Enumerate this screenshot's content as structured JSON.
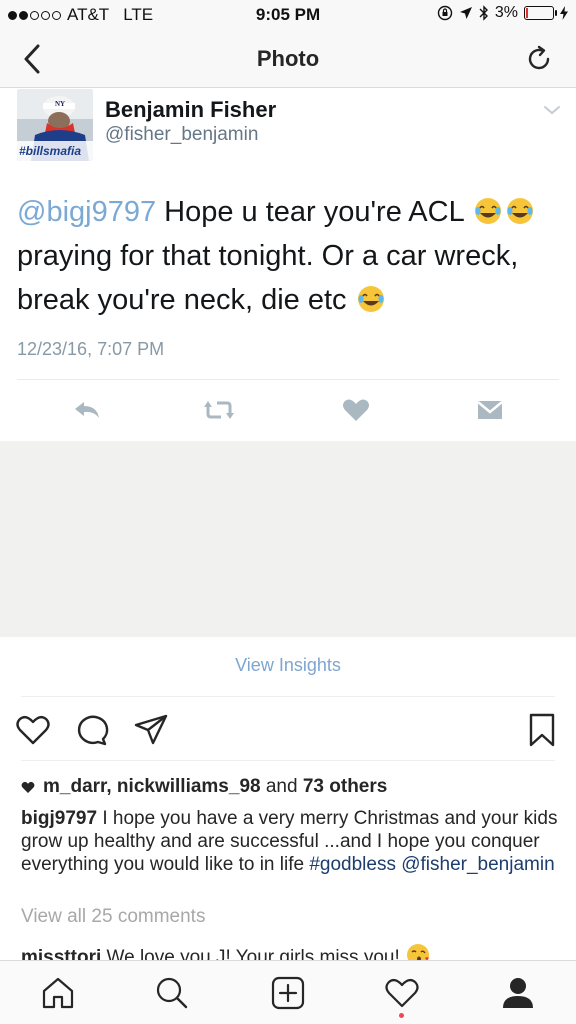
{
  "status_bar": {
    "carrier": "AT&T",
    "network": "LTE",
    "time": "9:05 PM",
    "battery_percent": "3%",
    "battery_level": 0.03
  },
  "nav": {
    "title": "Photo",
    "back_icon": "chevron-left-icon",
    "refresh_icon": "refresh-icon"
  },
  "tweet": {
    "name": "Benjamin Fisher",
    "handle": "@fisher_benjamin",
    "avatar_caption": "#billsmafia",
    "mention": "@bigj9797",
    "text_part1": " Hope u tear you're ACL ",
    "text_part2": " praying for that tonight. Or a car wreck, break you're neck, die etc ",
    "timestamp": "12/23/16, 7:07 PM",
    "actions": [
      "reply-icon",
      "retweet-icon",
      "like-icon",
      "message-icon"
    ]
  },
  "post": {
    "insights_label": "View Insights",
    "likes_users": "m_darr, nickwilliams_98",
    "likes_and": " and ",
    "likes_others": "73 others",
    "caption_user": "bigj9797",
    "caption_text": " I hope you have a very merry Christmas and your kids grow up healthy and are successful ...and I hope you conquer everything you would like to in life ",
    "caption_hashtag": "#godbless",
    "caption_mention": "@fisher_benjamin",
    "view_comments": "View all 25 comments",
    "comment_user": "missttori",
    "comment_text": " We love you J! Your girls miss you! "
  },
  "tab_bar": {
    "tabs": [
      "home-icon",
      "search-icon",
      "add-post-icon",
      "activity-icon",
      "profile-icon"
    ]
  },
  "colors": {
    "mention_blue": "#7aa9d6",
    "insights_blue": "#7ea6cf",
    "hashtag_navy": "#1d3d6e",
    "gray_area": "#f1f1ef",
    "battery_red": "#e0302b"
  }
}
